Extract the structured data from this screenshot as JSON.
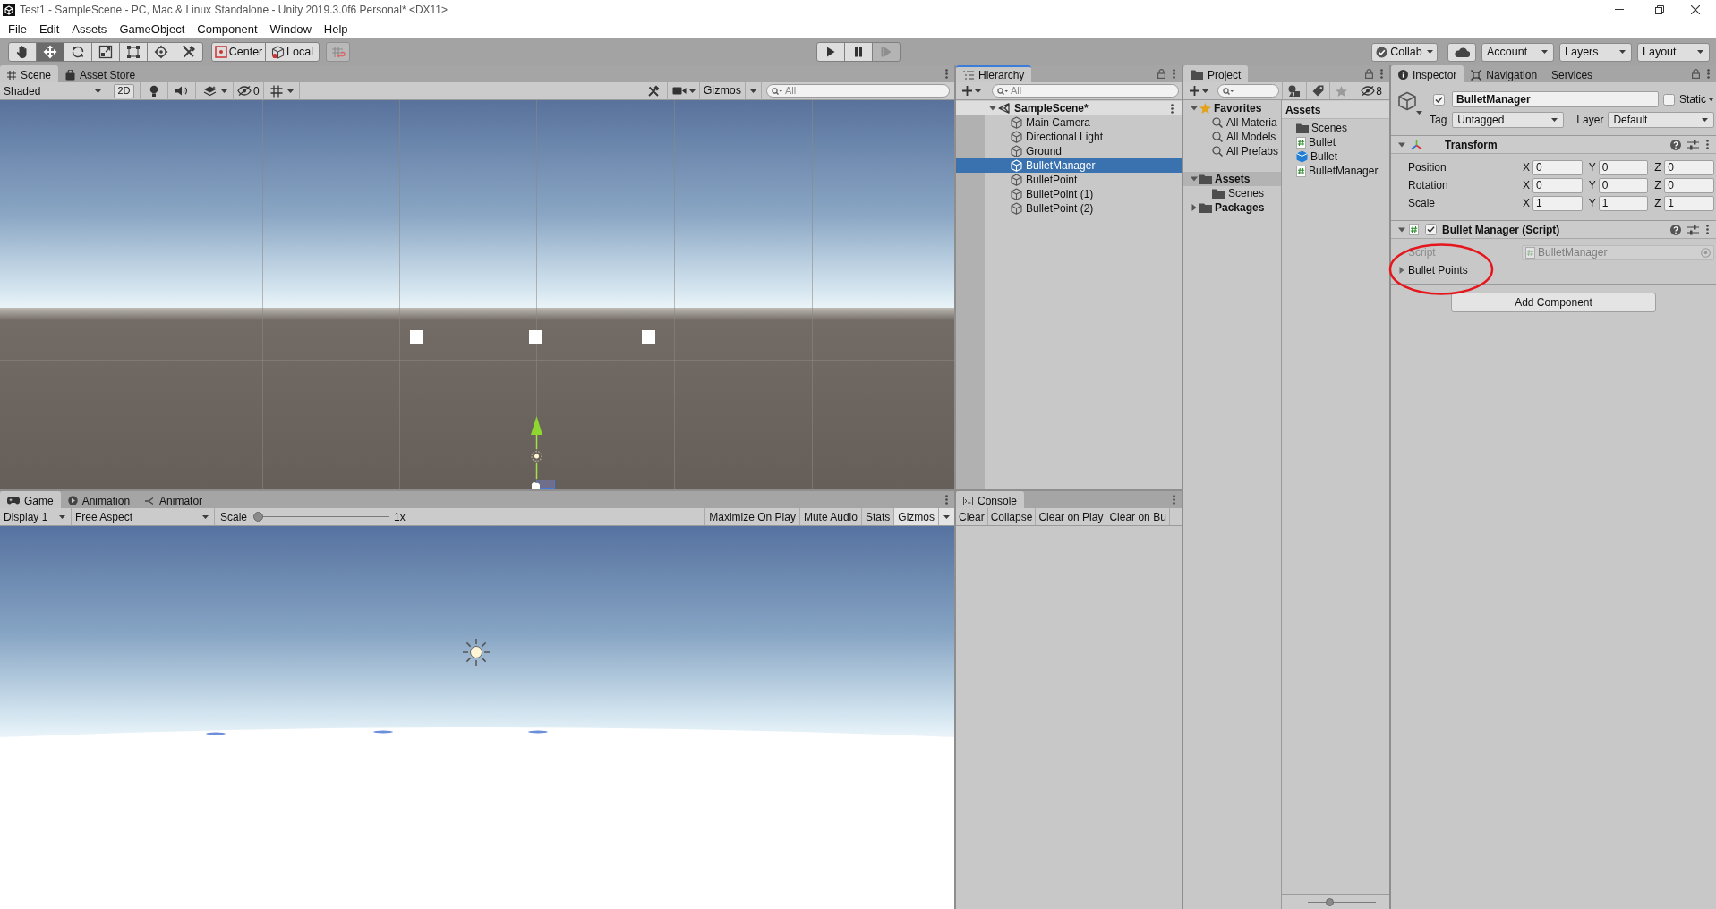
{
  "window": {
    "title": "Test1 - SampleScene - PC, Mac & Linux Standalone - Unity 2019.3.0f6 Personal* <DX11>"
  },
  "menu": [
    "File",
    "Edit",
    "Assets",
    "GameObject",
    "Component",
    "Window",
    "Help"
  ],
  "toolbar": {
    "tools": [
      {
        "kind": "hand",
        "selected": false
      },
      {
        "kind": "move",
        "selected": true
      },
      {
        "kind": "rotate",
        "selected": false
      },
      {
        "kind": "scale",
        "selected": false
      },
      {
        "kind": "rect",
        "selected": false
      },
      {
        "kind": "transform",
        "selected": false
      },
      {
        "kind": "custom",
        "selected": false
      }
    ],
    "pivot": [
      {
        "kind": "center",
        "label": "Center"
      },
      {
        "kind": "local",
        "label": "Local"
      }
    ],
    "playback": [
      {
        "kind": "play",
        "disabled": false
      },
      {
        "kind": "pause",
        "disabled": false
      },
      {
        "kind": "step",
        "disabled": true
      }
    ],
    "right": [
      {
        "kind": "collab",
        "label": "Collab"
      },
      {
        "kind": "cloud"
      },
      {
        "kind": "dropdown",
        "label": "Account"
      },
      {
        "kind": "dropdown",
        "label": "Layers"
      },
      {
        "kind": "dropdown",
        "label": "Layout"
      }
    ]
  },
  "scene": {
    "tabs": [
      {
        "kind": "scene",
        "label": "Scene",
        "selected": true
      },
      {
        "kind": "store",
        "label": "Asset Store",
        "selected": false
      }
    ],
    "shading": "Shaded",
    "mode_2d": "2D",
    "hidden_count": "0",
    "gizmos": "Gizmos",
    "search": {
      "placeholder": "All"
    }
  },
  "hierarchy": {
    "tabs": [
      {
        "kind": "hierarchy",
        "label": "Hierarchy",
        "selected": true,
        "focused": true
      }
    ],
    "search": {
      "placeholder": "All"
    },
    "scene": {
      "label": "SampleScene*",
      "expanded": true
    },
    "items": [
      {
        "label": "Main Camera",
        "selected": false
      },
      {
        "label": "Directional Light",
        "selected": false
      },
      {
        "label": "Ground",
        "selected": false
      },
      {
        "label": "BulletManager",
        "selected": true
      },
      {
        "label": "BulletPoint",
        "selected": false
      },
      {
        "label": "BulletPoint (1)",
        "selected": false
      },
      {
        "label": "BulletPoint (2)",
        "selected": false
      }
    ]
  },
  "project": {
    "tabs": [
      {
        "kind": "project",
        "label": "Project",
        "selected": true
      }
    ],
    "hidden_count": "8",
    "tree": [
      {
        "kind": "favorites",
        "label": "Favorites",
        "expanded": true,
        "selected": false,
        "children": [
          {
            "kind": "search",
            "label": "All Materia",
            "selected": false
          },
          {
            "kind": "search",
            "label": "All Models",
            "selected": false
          },
          {
            "kind": "search",
            "label": "All Prefabs",
            "selected": false
          }
        ]
      },
      {
        "kind": "folder",
        "label": "Assets",
        "expanded": true,
        "selected": true,
        "children": [
          {
            "kind": "folder",
            "label": "Scenes",
            "selected": false
          }
        ]
      },
      {
        "kind": "folder",
        "label": "Packages",
        "expanded": false,
        "selected": false
      }
    ],
    "path": "Assets",
    "assets": [
      {
        "kind": "folder",
        "label": "Scenes"
      },
      {
        "kind": "script",
        "label": "Bullet"
      },
      {
        "kind": "prefab",
        "label": "Bullet"
      },
      {
        "kind": "script",
        "label": "BulletManager"
      }
    ],
    "slider": {
      "level": 0.3
    }
  },
  "inspector": {
    "tabs": [
      {
        "kind": "inspector",
        "label": "Inspector",
        "selected": true
      },
      {
        "kind": "navigation",
        "label": "Navigation",
        "selected": false
      },
      {
        "kind": "services",
        "label": "Services",
        "selected": false
      }
    ],
    "object": {
      "active": true,
      "name": "BulletManager",
      "static": false,
      "static_label": "Static",
      "tag_label": "Tag",
      "tag": "Untagged",
      "layer_label": "Layer",
      "layer": "Default"
    },
    "components": [
      {
        "kind": "transform",
        "title": "Transform",
        "expanded": true,
        "rows": [
          {
            "label": "Position",
            "axes": [
              {
                "axis": "X",
                "value": "0"
              },
              {
                "axis": "Y",
                "value": "0"
              },
              {
                "axis": "Z",
                "value": "0"
              }
            ]
          },
          {
            "label": "Rotation",
            "axes": [
              {
                "axis": "X",
                "value": "0"
              },
              {
                "axis": "Y",
                "value": "0"
              },
              {
                "axis": "Z",
                "value": "0"
              }
            ]
          },
          {
            "label": "Scale",
            "axes": [
              {
                "axis": "X",
                "value": "1"
              },
              {
                "axis": "Y",
                "value": "1"
              },
              {
                "axis": "Z",
                "value": "1"
              }
            ]
          }
        ]
      },
      {
        "kind": "script",
        "title": "Bullet Manager (Script)",
        "enabled": true,
        "expanded": true,
        "script": {
          "label": "Script",
          "value": "BulletManager",
          "disabled": true
        },
        "properties": [
          {
            "label": "Bullet Points",
            "expanded": false
          }
        ]
      }
    ],
    "add_component": "Add Component"
  },
  "game": {
    "tabs": [
      {
        "kind": "game",
        "label": "Game",
        "selected": true
      },
      {
        "kind": "animation",
        "label": "Animation",
        "selected": false
      },
      {
        "kind": "animator",
        "label": "Animator",
        "selected": false
      }
    ],
    "display": "Display 1",
    "aspect": "Free Aspect",
    "scale": {
      "label": "Scale",
      "level": 0,
      "reading": "1x"
    },
    "toggles": [
      "Maximize On Play",
      "Mute Audio",
      "Stats"
    ],
    "gizmos": "Gizmos"
  },
  "console": {
    "tabs": [
      {
        "kind": "console",
        "label": "Console",
        "selected": true
      }
    ],
    "buttons": [
      "Clear",
      "Collapse",
      "Clear on Play",
      "Clear on Bu"
    ]
  }
}
